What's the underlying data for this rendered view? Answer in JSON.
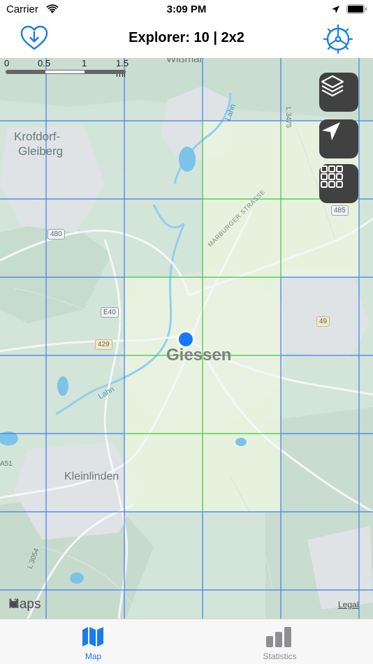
{
  "status": {
    "carrier": "Carrier",
    "time": "3:09 PM"
  },
  "nav": {
    "title": "Explorer: 10 | 2x2"
  },
  "map": {
    "scale": {
      "labels": [
        "0",
        "0.5",
        "1",
        "1.5 mi"
      ]
    },
    "labels": {
      "city": "Giessen",
      "krofdorf": "Krofdorf-",
      "gleiberg": "Gleiberg",
      "kleinlinden": "Kleinlinden",
      "lahn_north": "Lahn",
      "lahn_south": "Lahn",
      "marburger": "MARBURGER STRASSE",
      "wettenberg_top": "Wißmar",
      "l3475": "L 3475",
      "l3054": "L 3054",
      "a51": "A51"
    },
    "shields": {
      "s480": "480",
      "e40": "E40",
      "s429": "429",
      "s485": "485",
      "s49": "49"
    },
    "brand": "Maps",
    "legal": "Legal"
  },
  "tabs": {
    "map": "Map",
    "statistics": "Statistics"
  },
  "colors": {
    "accent": "#1a7cf0",
    "grid_blue": "#3c7ff0",
    "grid_green": "#3cc83c",
    "fab": "#414141",
    "explored": "#eaf5df"
  }
}
